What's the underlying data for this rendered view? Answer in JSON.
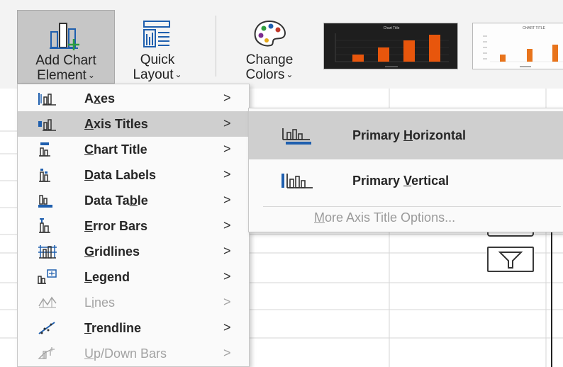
{
  "ribbon": {
    "add_chart_element": {
      "line1": "Add Chart",
      "line2": "Element"
    },
    "quick_layout": {
      "line1": "Quick",
      "line2": "Layout"
    },
    "change_colors": {
      "line1": "Change",
      "line2": "Colors"
    },
    "chart_styles": [
      {
        "title": "Chart Title",
        "bar_color": "#e8560c",
        "background": "#1e1e1e"
      },
      {
        "title": "CHART TITLE",
        "bar_color": "#e8741c",
        "background": "#fdfdfd"
      }
    ]
  },
  "menu": {
    "items": [
      {
        "label": "Axes",
        "icon": "axes-icon",
        "has_submenu": true,
        "enabled": true,
        "highlighted": false
      },
      {
        "label": "Axis Titles",
        "icon": "axis-titles-icon",
        "has_submenu": true,
        "enabled": true,
        "highlighted": true
      },
      {
        "label": "Chart Title",
        "icon": "chart-title-icon",
        "has_submenu": true,
        "enabled": true,
        "highlighted": false
      },
      {
        "label": "Data Labels",
        "icon": "data-labels-icon",
        "has_submenu": true,
        "enabled": true,
        "highlighted": false
      },
      {
        "label": "Data Table",
        "icon": "data-table-icon",
        "has_submenu": true,
        "enabled": true,
        "highlighted": false
      },
      {
        "label": "Error Bars",
        "icon": "error-bars-icon",
        "has_submenu": true,
        "enabled": true,
        "highlighted": false
      },
      {
        "label": "Gridlines",
        "icon": "gridlines-icon",
        "has_submenu": true,
        "enabled": true,
        "highlighted": false
      },
      {
        "label": "Legend",
        "icon": "legend-icon",
        "has_submenu": true,
        "enabled": true,
        "highlighted": false
      },
      {
        "label": "Lines",
        "icon": "lines-icon",
        "has_submenu": true,
        "enabled": false,
        "highlighted": false
      },
      {
        "label": "Trendline",
        "icon": "trendline-icon",
        "has_submenu": true,
        "enabled": true,
        "highlighted": false
      },
      {
        "label": "Up/Down Bars",
        "icon": "up-down-bars-icon",
        "has_submenu": true,
        "enabled": false,
        "highlighted": false
      }
    ],
    "arrow": ">"
  },
  "submenu": {
    "items": [
      {
        "label": "Primary Horizontal",
        "icon": "primary-horizontal-axis-title-icon",
        "highlighted": true
      },
      {
        "label": "Primary Vertical",
        "icon": "primary-vertical-axis-title-icon",
        "highlighted": false
      }
    ],
    "more_options": "More Axis Title Options..."
  },
  "colors": {
    "ribbon_bg": "#f3f3f3",
    "highlight": "#cfcfcf",
    "menu_bg": "#fafafa",
    "icon_blue": "#1f5fae",
    "accent_green": "#2e9e3e",
    "disabled_text": "#a3a3a3"
  }
}
